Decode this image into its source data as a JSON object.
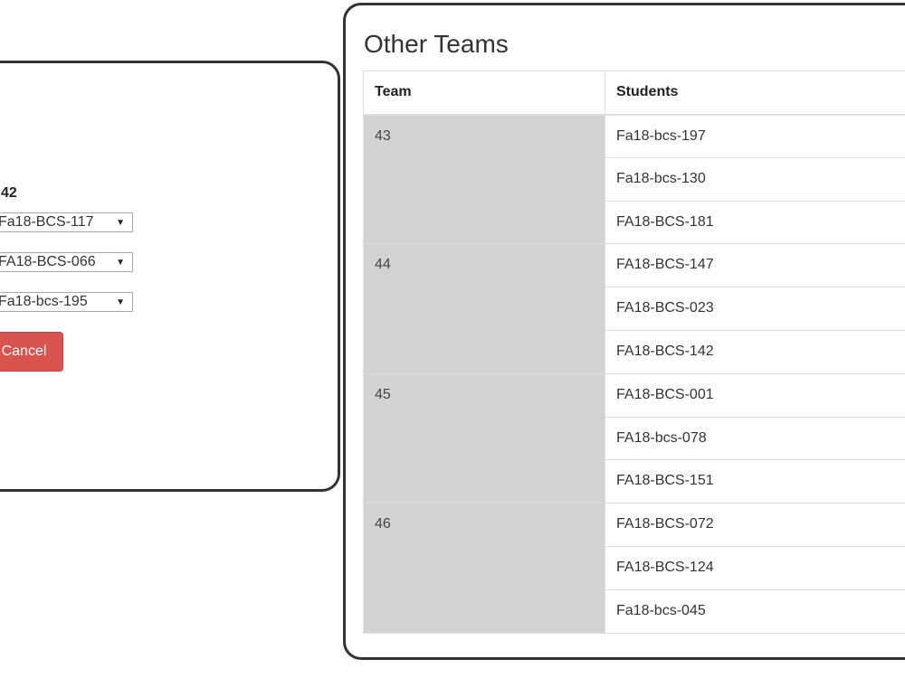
{
  "edit_panel": {
    "team_label": "42",
    "selects": [
      {
        "value": "Fa18-BCS-117"
      },
      {
        "value": "FA18-BCS-066"
      },
      {
        "value": "Fa18-bcs-195"
      }
    ],
    "cancel_label": "Cancel",
    "icons": {
      "dropdown": "triangle-down-icon"
    }
  },
  "other_teams": {
    "title": "Other Teams",
    "columns": [
      "Team",
      "Students"
    ],
    "teams": [
      {
        "team": "43",
        "students": [
          "Fa18-bcs-197",
          "Fa18-bcs-130",
          "FA18-BCS-181"
        ]
      },
      {
        "team": "44",
        "students": [
          "FA18-BCS-147",
          "FA18-BCS-023",
          "FA18-BCS-142"
        ]
      },
      {
        "team": "45",
        "students": [
          "FA18-BCS-001",
          "FA18-bcs-078",
          "FA18-BCS-151"
        ]
      },
      {
        "team": "46",
        "students": [
          "FA18-BCS-072",
          "FA18-BCS-124",
          "Fa18-bcs-045"
        ]
      }
    ]
  },
  "colors": {
    "panel_border": "#333333",
    "team_cell_bg": "#d3d3d3",
    "cancel_bg": "#d9534f",
    "table_border": "#dddddd"
  }
}
